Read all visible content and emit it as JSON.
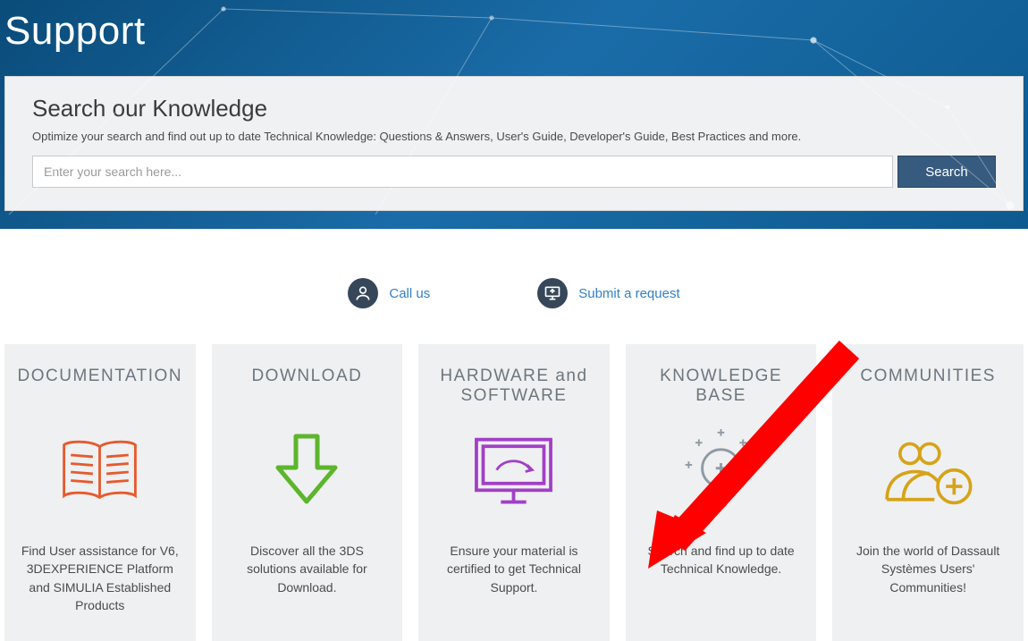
{
  "hero": {
    "title": "Support"
  },
  "search": {
    "heading": "Search our Knowledge",
    "subtext": "Optimize your search and find out up to date Technical Knowledge: Questions & Answers, User's Guide, Developer's Guide, Best Practices and more.",
    "placeholder": "Enter your search here...",
    "button": "Search"
  },
  "actions": {
    "call": "Call us",
    "submit": "Submit a request"
  },
  "cards": [
    {
      "title": "DOCUMENTATION",
      "desc": "Find User assistance for V6, 3DEXPERIENCE Platform and SIMULIA Established Products",
      "icon": "book-icon",
      "color": "#e65a2e"
    },
    {
      "title": "DOWNLOAD",
      "desc": "Discover all the 3DS solutions available for Download.",
      "icon": "download-arrow-icon",
      "color": "#5cb52c"
    },
    {
      "title": "HARDWARE and SOFTWARE",
      "desc": "Ensure your material is certified to get Technical Support.",
      "icon": "monitor-icon",
      "color": "#a23fc6"
    },
    {
      "title": "KNOWLEDGE BASE",
      "desc": "Search and find up to date Technical Knowledge.",
      "icon": "lightbulb-icon",
      "color": "#8e9aa3"
    },
    {
      "title": "COMMUNITIES",
      "desc": "Join the world of Dassault Systèmes Users' Communities!",
      "icon": "people-icon",
      "color": "#d6a319"
    }
  ],
  "annotation": {
    "arrow_color": "#ff0000",
    "target": "submit-request-link"
  }
}
